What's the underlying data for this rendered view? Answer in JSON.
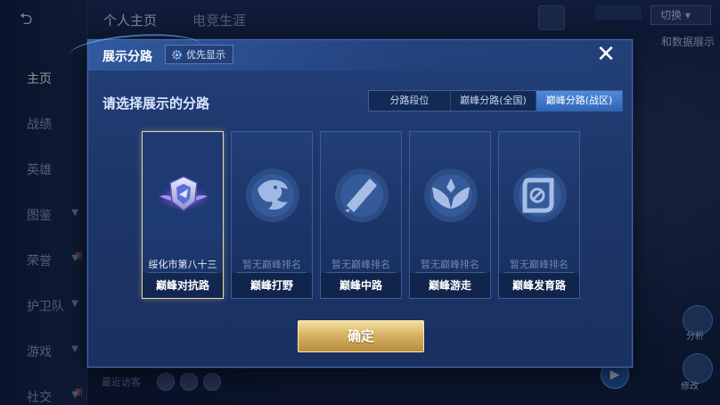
{
  "background": {
    "tabs": [
      "个人主页",
      "电竞生涯"
    ],
    "side_menu": [
      {
        "label": "主页",
        "active": true
      },
      {
        "label": "战绩"
      },
      {
        "label": "英雄"
      },
      {
        "label": "图鉴",
        "chevron": true
      },
      {
        "label": "荣誉",
        "chevron": true,
        "tag": "新"
      },
      {
        "label": "护卫队",
        "chevron": true
      },
      {
        "label": "游戏",
        "chevron": true
      },
      {
        "label": "社交",
        "chevron": true,
        "tag": "新"
      }
    ],
    "recent_visitors_label": "最近访客",
    "top_right_select": "切换",
    "right_panel_text": "和数据展示",
    "bottom_right_labels": [
      "分析",
      "修改"
    ]
  },
  "modal": {
    "title": "展示分路",
    "priority_button": "优先显示",
    "close_icon": "close-icon",
    "subtitle": "请选择展示的分路",
    "filter_tabs": [
      {
        "label": "分路段位",
        "active": false
      },
      {
        "label": "巅峰分路(全国)",
        "active": false
      },
      {
        "label": "巅峰分路(战区)",
        "active": true
      }
    ],
    "cards": [
      {
        "icon": "clash-lane-crest-icon",
        "rank": "绥化市第八十三",
        "label": "巅峰对抗路",
        "selected": true
      },
      {
        "icon": "jungle-dragon-icon",
        "rank": "暂无巅峰排名",
        "label": "巅峰打野",
        "selected": false
      },
      {
        "icon": "mid-lane-blade-icon",
        "rank": "暂无巅峰排名",
        "label": "巅峰中路",
        "selected": false
      },
      {
        "icon": "roam-wings-icon",
        "rank": "暂无巅峰排名",
        "label": "巅峰游走",
        "selected": false
      },
      {
        "icon": "farm-lane-target-icon",
        "rank": "暂无巅峰排名",
        "label": "巅峰发育路",
        "selected": false
      }
    ],
    "confirm_button": "确定"
  },
  "colors": {
    "accent_gold": "#d7b264",
    "selected_border": "#e8d9a6",
    "active_tab": "#3f78cc",
    "modal_bg": "#1d3668"
  }
}
